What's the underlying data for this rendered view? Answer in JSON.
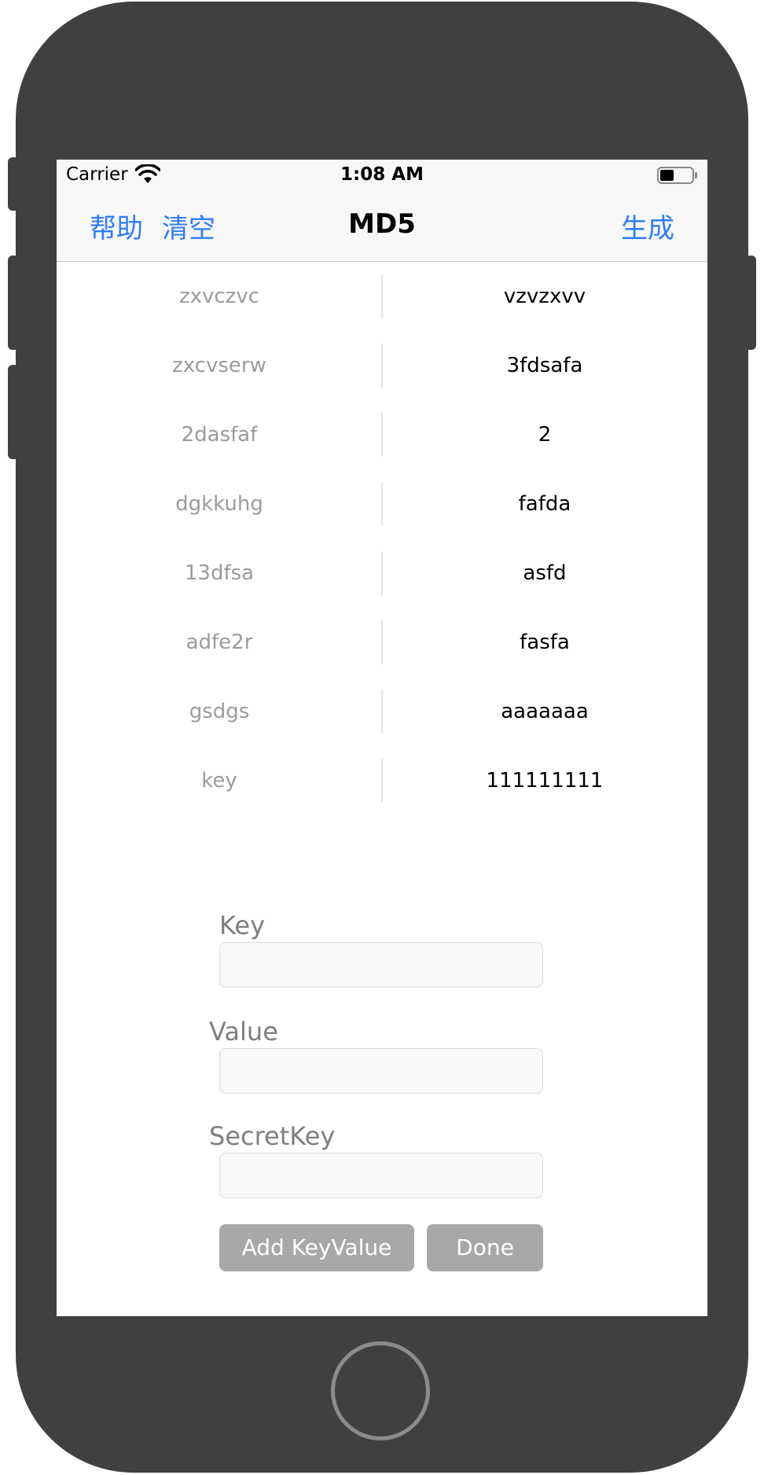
{
  "status_bar": {
    "carrier": "Carrier",
    "time": "1:08 AM",
    "wifi_icon": "wifi-icon",
    "battery_icon": "battery-icon"
  },
  "nav_bar": {
    "help_label": "帮助",
    "clear_label": "清空",
    "title": "MD5",
    "generate_label": "生成",
    "accent_color": "#2f7cf6"
  },
  "table": {
    "rows": [
      {
        "key": "zxvczvc",
        "value": "vzvzxvv"
      },
      {
        "key": "zxcvserw",
        "value": "3fdsafa"
      },
      {
        "key": "2dasfaf",
        "value": "2"
      },
      {
        "key": "dgkkuhg",
        "value": "fafda"
      },
      {
        "key": "13dfsa",
        "value": "asfd"
      },
      {
        "key": "adfe2r",
        "value": "fasfa"
      },
      {
        "key": "gsdgs",
        "value": "aaaaaaa"
      },
      {
        "key": "key",
        "value": "111111111"
      }
    ]
  },
  "form": {
    "key_label": "Key",
    "key_value": "",
    "value_label": "Value",
    "value_value": "",
    "secret_label": "SecretKey",
    "secret_value": "",
    "add_button_label": "Add KeyValue",
    "done_button_label": "Done",
    "button_color": "#a8a8a8"
  }
}
